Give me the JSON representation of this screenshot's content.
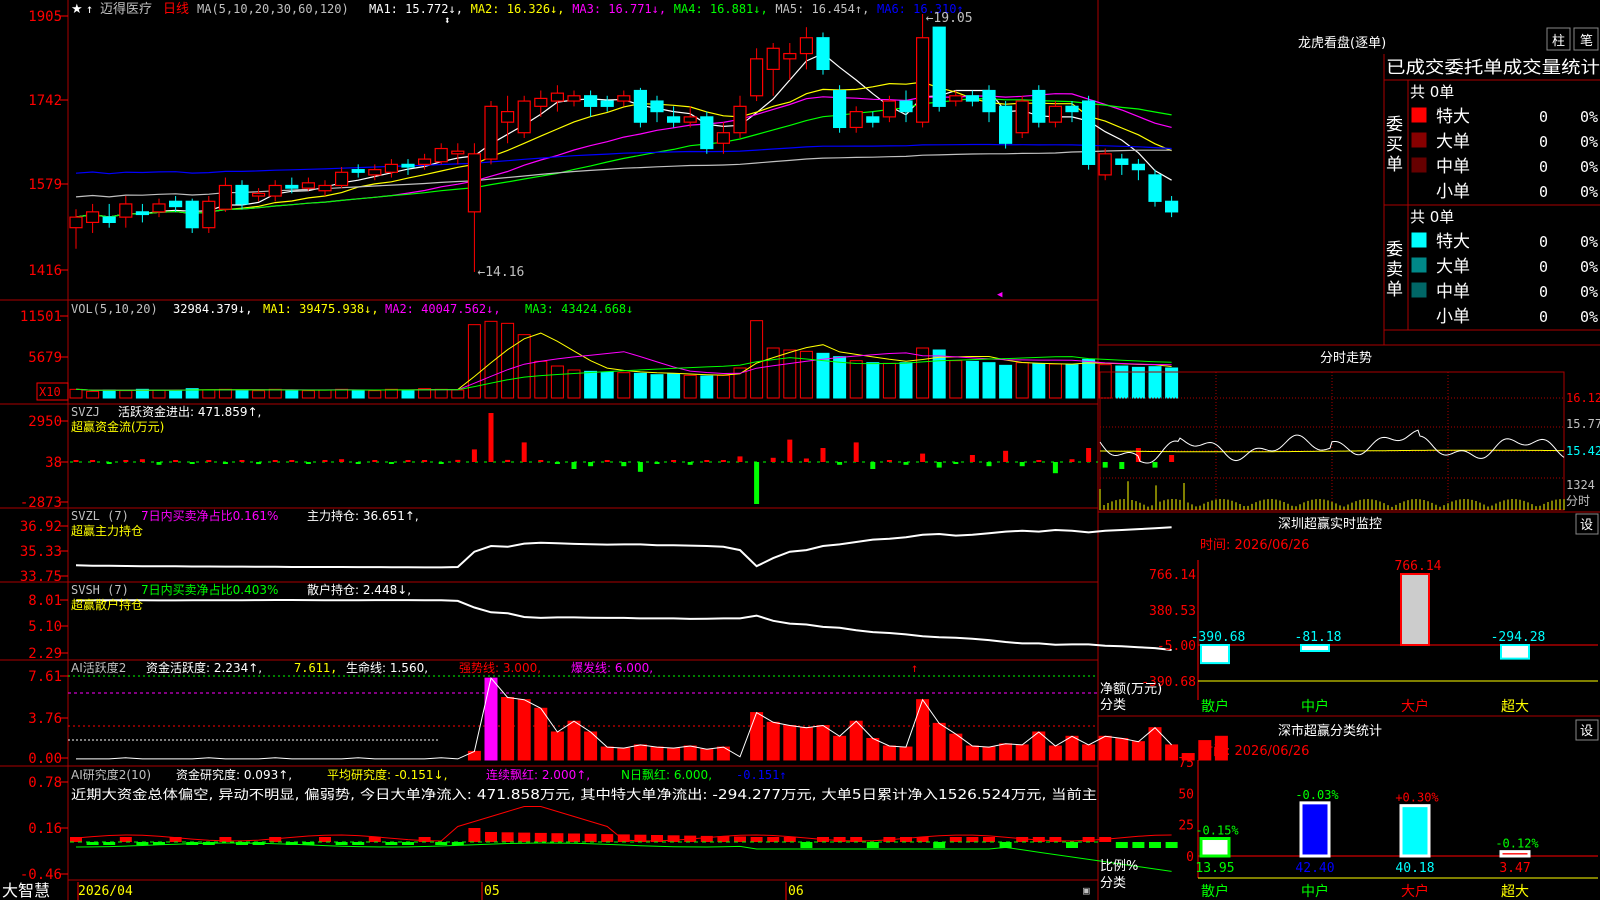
{
  "stock": {
    "name": "迈得医疗",
    "period": "日线"
  },
  "brand": "大智慧",
  "dates": {
    "d1": "2026/04",
    "d2": "05",
    "d3": "06"
  },
  "kline": {
    "ma_header": "MA(5,10,20,30,60,120)",
    "ma": [
      {
        "label": "MA1: 15.772↓,",
        "color": "#ffffff"
      },
      {
        "label": "MA2: 16.326↓,",
        "color": "#ffff00"
      },
      {
        "label": "MA3: 16.771↓,",
        "color": "#ff00ff"
      },
      {
        "label": "MA4: 16.881↓,",
        "color": "#00ff00"
      },
      {
        "label": "MA5: 16.454↑,",
        "color": "#c0c0c0"
      },
      {
        "label": "MA6: 16.310↑",
        "color": "#0000ff"
      }
    ],
    "yticks": [
      "1905",
      "1742",
      "1579",
      "1416"
    ],
    "high_label": "←19.05",
    "low_label": "←14.16",
    "ymin": 14.16,
    "ymax": 19.05,
    "ohlc": [
      [
        15.0,
        15.2,
        14.6,
        15.35
      ],
      [
        15.1,
        15.3,
        14.9,
        15.45
      ],
      [
        15.2,
        15.1,
        15.0,
        15.45
      ],
      [
        15.2,
        15.45,
        15.0,
        15.6
      ],
      [
        15.3,
        15.25,
        15.1,
        15.45
      ],
      [
        15.3,
        15.45,
        15.2,
        15.55
      ],
      [
        15.5,
        15.4,
        15.3,
        15.6
      ],
      [
        15.5,
        15.0,
        14.9,
        15.55
      ],
      [
        15.0,
        15.5,
        14.9,
        15.6
      ],
      [
        15.35,
        15.8,
        15.3,
        15.95
      ],
      [
        15.8,
        15.45,
        15.35,
        15.9
      ],
      [
        15.6,
        15.65,
        15.5,
        15.75
      ],
      [
        15.6,
        15.8,
        15.5,
        15.9
      ],
      [
        15.8,
        15.75,
        15.65,
        15.95
      ],
      [
        15.75,
        15.85,
        15.7,
        15.95
      ],
      [
        15.7,
        15.8,
        15.6,
        15.9
      ],
      [
        15.8,
        16.05,
        15.75,
        16.15
      ],
      [
        16.1,
        16.05,
        15.95,
        16.2
      ],
      [
        16.0,
        16.1,
        15.9,
        16.2
      ],
      [
        16.05,
        16.2,
        15.95,
        16.3
      ],
      [
        16.2,
        16.15,
        16.0,
        16.3
      ],
      [
        16.2,
        16.3,
        16.1,
        16.4
      ],
      [
        16.25,
        16.5,
        16.2,
        16.6
      ],
      [
        16.4,
        16.45,
        16.2,
        16.6
      ],
      [
        15.3,
        16.4,
        14.16,
        16.6
      ],
      [
        16.3,
        17.3,
        16.2,
        17.4
      ],
      [
        17.0,
        17.2,
        16.6,
        17.5
      ],
      [
        16.8,
        17.4,
        16.7,
        17.5
      ],
      [
        17.3,
        17.45,
        17.1,
        17.6
      ],
      [
        17.4,
        17.55,
        17.2,
        17.7
      ],
      [
        17.4,
        17.5,
        17.3,
        17.6
      ],
      [
        17.5,
        17.3,
        17.1,
        17.6
      ],
      [
        17.4,
        17.3,
        17.2,
        17.5
      ],
      [
        17.4,
        17.5,
        17.3,
        17.6
      ],
      [
        17.6,
        17.0,
        16.9,
        17.65
      ],
      [
        17.4,
        17.2,
        17.0,
        17.5
      ],
      [
        17.1,
        17.0,
        16.9,
        17.3
      ],
      [
        17.0,
        17.1,
        16.9,
        17.3
      ],
      [
        17.1,
        16.5,
        16.4,
        17.2
      ],
      [
        16.6,
        16.8,
        16.4,
        17.0
      ],
      [
        16.8,
        17.3,
        16.7,
        17.5
      ],
      [
        17.5,
        18.2,
        17.4,
        18.4
      ],
      [
        18.0,
        18.4,
        17.5,
        18.5
      ],
      [
        18.2,
        18.3,
        17.8,
        18.5
      ],
      [
        18.3,
        18.6,
        18.0,
        18.8
      ],
      [
        18.6,
        18.0,
        17.9,
        18.7
      ],
      [
        17.6,
        16.9,
        16.8,
        17.7
      ],
      [
        16.9,
        17.2,
        16.8,
        17.3
      ],
      [
        17.1,
        17.0,
        16.9,
        17.2
      ],
      [
        17.1,
        17.4,
        17.0,
        17.5
      ],
      [
        17.4,
        17.2,
        17.0,
        17.6
      ],
      [
        17.0,
        18.6,
        16.9,
        19.05
      ],
      [
        18.8,
        17.3,
        17.2,
        18.8
      ],
      [
        17.4,
        17.5,
        17.3,
        17.6
      ],
      [
        17.5,
        17.4,
        17.3,
        17.6
      ],
      [
        17.6,
        17.2,
        17.0,
        17.7
      ],
      [
        17.3,
        16.6,
        16.5,
        17.4
      ],
      [
        16.8,
        17.4,
        16.7,
        17.5
      ],
      [
        17.6,
        17.0,
        16.9,
        17.7
      ],
      [
        17.0,
        17.3,
        16.9,
        17.4
      ],
      [
        17.3,
        17.2,
        17.0,
        17.4
      ],
      [
        17.4,
        16.2,
        16.1,
        17.5
      ],
      [
        16.0,
        16.4,
        15.9,
        16.5
      ],
      [
        16.3,
        16.2,
        16.0,
        16.4
      ],
      [
        16.2,
        16.1,
        15.9,
        16.3
      ],
      [
        16.0,
        15.5,
        15.4,
        16.1
      ],
      [
        15.5,
        15.3,
        15.2,
        15.6
      ]
    ]
  },
  "vol": {
    "title": "VOL(5,10,20)",
    "value": "32984.379↓,",
    "ma1": "MA1: 39475.938↓,",
    "ma2": "MA2: 40047.562↓,",
    "ma3": "MA3: 43424.668↓",
    "yticks": [
      "11501",
      "5679"
    ],
    "unit": "X10",
    "values": [
      1300,
      1000,
      1200,
      1100,
      1300,
      1200,
      1100,
      1400,
      1200,
      1300,
      1200,
      1100,
      1300,
      1200,
      1100,
      1200,
      1300,
      1200,
      1100,
      1300,
      1200,
      1400,
      1300,
      1200,
      11000,
      11500,
      11200,
      9500,
      5500,
      4800,
      4200,
      4000,
      3900,
      3800,
      3700,
      3500,
      3600,
      3400,
      3300,
      3400,
      4500,
      11600,
      7500,
      7200,
      7000,
      6700,
      6200,
      5600,
      5300,
      5200,
      5300,
      7500,
      7200,
      5600,
      5500,
      5300,
      4900,
      5300,
      5100,
      5100,
      5000,
      5800,
      5000,
      4800,
      4600,
      4700,
      4500
    ]
  },
  "svzj": {
    "title": "SVZJ",
    "label": "活跃资金进出: 471.859↑,",
    "sub": "超赢资金流(万元)",
    "yticks": [
      "2950",
      "38",
      "-2873"
    ],
    "values": [
      0,
      0,
      -100,
      0,
      200,
      -200,
      0,
      -100,
      0,
      -100,
      100,
      -150,
      0,
      100,
      -100,
      0,
      200,
      -100,
      100,
      -100,
      100,
      0,
      -100,
      150,
      900,
      3500,
      150,
      1400,
      0,
      -100,
      -500,
      -300,
      100,
      -300,
      -700,
      -100,
      100,
      -200,
      100,
      0,
      400,
      -3000,
      300,
      1600,
      250,
      1000,
      -200,
      1400,
      -500,
      100,
      -200,
      600,
      -400,
      -100,
      500,
      -300,
      800,
      -300,
      0,
      -800,
      200,
      1000,
      -400,
      -500,
      1000,
      -400,
      500
    ]
  },
  "svzl": {
    "title": "SVZL (7)",
    "desc": "7日内买卖净占比0.161%",
    "label": "主力持仓: 36.651↑,",
    "sub": "超赢主力持仓",
    "yticks": [
      "36.92",
      "35.33",
      "33.75"
    ],
    "ymin": 33.75,
    "ymax": 36.92,
    "line": [
      34.35,
      34.33,
      34.32,
      34.31,
      34.3,
      34.3,
      34.29,
      34.28,
      34.28,
      34.27,
      34.27,
      34.26,
      34.26,
      34.25,
      34.25,
      34.25,
      34.25,
      34.24,
      34.24,
      34.23,
      34.23,
      34.22,
      34.22,
      34.25,
      35.2,
      35.55,
      35.5,
      35.7,
      35.75,
      35.72,
      35.68,
      35.66,
      35.64,
      35.65,
      35.65,
      35.6,
      35.6,
      35.58,
      35.55,
      35.5,
      35.3,
      34.3,
      34.8,
      35.2,
      35.3,
      35.55,
      35.65,
      35.8,
      35.95,
      36.0,
      36.1,
      36.25,
      36.3,
      36.2,
      36.25,
      36.35,
      36.45,
      36.5,
      36.45,
      36.55,
      36.5,
      36.4,
      36.5,
      36.55,
      36.6,
      36.65,
      36.72
    ]
  },
  "svsh": {
    "title": "SVSH (7)",
    "desc": "7日内买卖净占比0.403%",
    "label": "散户持仓: 2.448↓,",
    "sub": "超赢散户持仓",
    "yticks": [
      "8.01",
      "5.10",
      "2.29"
    ],
    "ymin": 2.29,
    "ymax": 8.01,
    "line": [
      7.75,
      7.77,
      7.78,
      7.78,
      7.77,
      7.76,
      7.76,
      7.77,
      7.77,
      7.78,
      7.78,
      7.79,
      7.8,
      7.8,
      7.79,
      7.78,
      7.78,
      7.77,
      7.79,
      7.79,
      7.79,
      7.78,
      7.78,
      7.7,
      7.0,
      6.5,
      6.4,
      6.0,
      5.9,
      5.95,
      5.95,
      5.92,
      5.9,
      5.9,
      5.85,
      5.85,
      5.85,
      5.8,
      5.82,
      5.85,
      5.85,
      6.15,
      5.6,
      5.3,
      5.2,
      4.95,
      4.85,
      4.6,
      4.4,
      4.3,
      4.15,
      3.95,
      3.85,
      3.8,
      3.7,
      3.55,
      3.35,
      3.2,
      3.2,
      3.05,
      3.1,
      3.1,
      2.95,
      2.9,
      2.8,
      2.7,
      2.5
    ]
  },
  "ai1": {
    "title": "AI活跃度2",
    "l1": "资金活跃度: 2.234↑,",
    "l2": "7.611,",
    "l3": "生命线: 1.560,",
    "l4": "强势线: 3.000,",
    "l5": "爆发线: 6.000,",
    "yticks": [
      "7.61",
      "3.76",
      "0.00"
    ],
    "ymax": 7.61,
    "values": [
      0.1,
      0.1,
      0.1,
      0.2,
      0.1,
      0.1,
      0.1,
      0.1,
      0.2,
      0.1,
      0.1,
      0.1,
      0.2,
      0.1,
      0.1,
      0.1,
      0.1,
      0.2,
      0.1,
      0.1,
      0.1,
      0.1,
      0.2,
      0.1,
      0.8,
      7.6,
      5.8,
      5.6,
      4.8,
      2.6,
      3.6,
      2.6,
      1.2,
      1.1,
      1.4,
      1.2,
      1.1,
      1.3,
      1.0,
      1.2,
      0.3,
      4.4,
      3.5,
      3.2,
      3.0,
      3.2,
      2.2,
      3.6,
      2.0,
      1.3,
      1.2,
      5.6,
      3.4,
      2.4,
      1.3,
      1.2,
      1.5,
      1.4,
      2.6,
      1.3,
      2.2,
      1.4,
      2.2,
      2.0,
      1.7,
      3.0,
      1.4,
      0.6,
      1.8,
      2.2
    ]
  },
  "ai2": {
    "title": "AI研究度2(10)",
    "l1": "资金研究度: 0.093↑,",
    "l2": "平均研究度: -0.151↓,",
    "l3": "连续飘红: 2.000↑,",
    "l4": "N日飘红: 6.000,",
    "l5": "-0.151↑",
    "summary": "近期大资金总体偏空, 异动不明显, 偏弱势, 今日大单净流入: 471.858万元, 其中特大单净流出: -294.277万元, 大单5日累计净入1526.524万元, 当前主",
    "yticks": [
      "0.78",
      "0.16",
      "-0.46"
    ]
  },
  "lhb": {
    "title": "龙虎看盘(逐单)",
    "btn_bar": "柱",
    "btn_stroke": "笔",
    "tabs": "已成交委托单成交量统计",
    "buy_side": "委买单",
    "sell_side": "委卖单",
    "buy_total": "共 0单",
    "sell_total": "共 0单",
    "buy_rows": [
      {
        "name": "特大",
        "count": "0",
        "pct": "0%",
        "color": "#ff0000"
      },
      {
        "name": "大单",
        "count": "0",
        "pct": "0%",
        "color": "#880000"
      },
      {
        "name": "中单",
        "count": "0",
        "pct": "0%",
        "color": "#660000"
      },
      {
        "name": "小单",
        "count": "0",
        "pct": "0%",
        "color": "#000000"
      }
    ],
    "sell_rows": [
      {
        "name": "特大",
        "count": "0",
        "pct": "0%",
        "color": "#00ffff"
      },
      {
        "name": "大单",
        "count": "0",
        "pct": "0%",
        "color": "#008888"
      },
      {
        "name": "中单",
        "count": "0",
        "pct": "0%",
        "color": "#006666"
      },
      {
        "name": "小单",
        "count": "0",
        "pct": "0%",
        "color": "#000000"
      }
    ]
  },
  "intraday": {
    "title": "分时走势",
    "yticks": [
      "16.12",
      "15.77",
      "15.42"
    ],
    "vol_label": "1324",
    "unit_label": "分时"
  },
  "sz_monitor": {
    "title": "深圳超赢实时监控",
    "time": "时间: 2026/06/26",
    "btn": "设",
    "yticks": [
      "766.14",
      "380.53",
      "-5.00",
      "-390.68"
    ],
    "y_label1": "净额(万元)",
    "y_label2": "分类",
    "bars": [
      {
        "cat": "散户",
        "value": -390.68,
        "label": "-390.68"
      },
      {
        "cat": "中户",
        "value": -81.18,
        "label": "-81.18"
      },
      {
        "cat": "大户",
        "value": 766.14,
        "label": "766.14"
      },
      {
        "cat": "超大",
        "value": -294.28,
        "label": "-294.28"
      }
    ]
  },
  "sz_stats": {
    "title": "深市超赢分类统计",
    "time": "时间: 2026/06/26",
    "btn": "设",
    "yticks": [
      "75",
      "50",
      "25",
      "0"
    ],
    "y_label1": "比例%",
    "y_label2": "分类",
    "bars": [
      {
        "cat": "散户",
        "value": 13.95,
        "label": "13.95",
        "delta": "-0.15%",
        "color": "#ffffff"
      },
      {
        "cat": "中户",
        "value": 42.4,
        "label": "42.40",
        "delta": "-0.03%",
        "color": "#0000ff"
      },
      {
        "cat": "大户",
        "value": 40.18,
        "label": "40.18",
        "delta": "+0.30%",
        "color": "#00ffff"
      },
      {
        "cat": "超大",
        "value": 3.47,
        "label": "3.47",
        "delta": "-0.12%",
        "color": "#ff0000"
      }
    ]
  }
}
